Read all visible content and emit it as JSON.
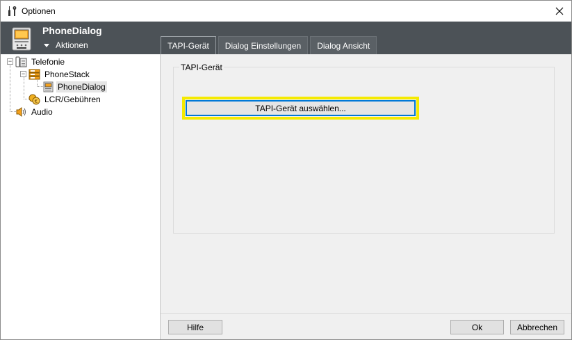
{
  "window": {
    "title": "Optionen"
  },
  "header": {
    "title": "PhoneDialog",
    "actions_label": "Aktionen"
  },
  "tabs": [
    {
      "label": "TAPI-Gerät",
      "active": true
    },
    {
      "label": "Dialog Einstellungen",
      "active": false
    },
    {
      "label": "Dialog Ansicht",
      "active": false
    }
  ],
  "tree": {
    "items": [
      {
        "label": "Telefonie",
        "level": 0,
        "expanded": true
      },
      {
        "label": "PhoneStack",
        "level": 1,
        "expanded": true
      },
      {
        "label": "PhoneDialog",
        "level": 2,
        "selected": true
      },
      {
        "label": "LCR/Gebühren",
        "level": 1
      },
      {
        "label": "Audio",
        "level": 0
      }
    ]
  },
  "content": {
    "group_title": "TAPI-Gerät",
    "select_button": "TAPI-Gerät auswählen..."
  },
  "footer": {
    "help": "Hilfe",
    "ok": "Ok",
    "cancel": "Abbrechen"
  },
  "colors": {
    "header_bg": "#4c5257",
    "highlight": "#f5ea00",
    "focus_border": "#0078d7"
  }
}
